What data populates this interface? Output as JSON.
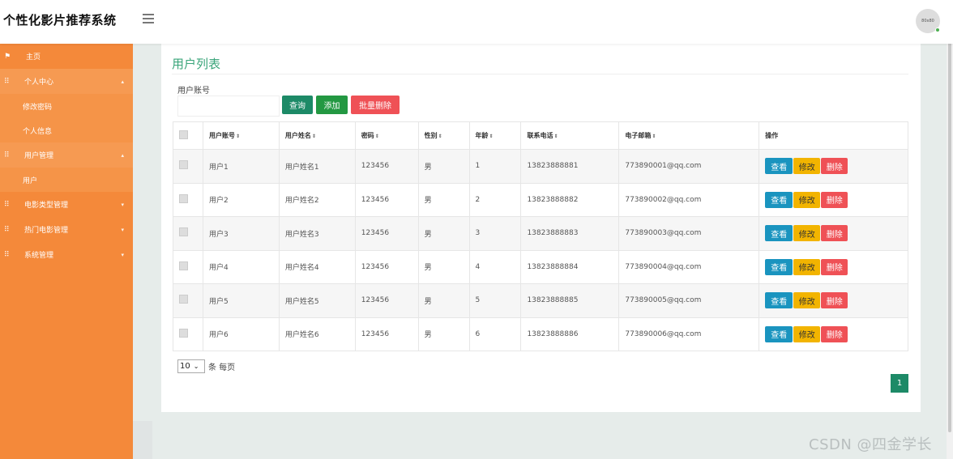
{
  "header": {
    "title": "个性化影片推荐系统",
    "avatar_text": "80x80"
  },
  "sidebar": {
    "home": "主页",
    "personal_center": "个人中心",
    "change_password": "修改密码",
    "personal_info": "个人信息",
    "user_management": "用户管理",
    "users": "用户",
    "movie_type_management": "电影类型管理",
    "hot_movie_management": "热门电影管理",
    "system_management": "系统管理"
  },
  "main": {
    "title": "用户列表",
    "search_label": "用户账号",
    "search_value": "",
    "buttons": {
      "query": "查询",
      "add": "添加",
      "batch_delete": "批量删除"
    },
    "columns": [
      "用户账号",
      "用户姓名",
      "密码",
      "性别",
      "年龄",
      "联系电话",
      "电子邮箱",
      "操作"
    ],
    "sort_icon": "⇕",
    "rows": [
      {
        "account": "用户1",
        "name": "用户姓名1",
        "password": "123456",
        "gender": "男",
        "age": "1",
        "phone": "13823888881",
        "email": "773890001@qq.com"
      },
      {
        "account": "用户2",
        "name": "用户姓名2",
        "password": "123456",
        "gender": "男",
        "age": "2",
        "phone": "13823888882",
        "email": "773890002@qq.com"
      },
      {
        "account": "用户3",
        "name": "用户姓名3",
        "password": "123456",
        "gender": "男",
        "age": "3",
        "phone": "13823888883",
        "email": "773890003@qq.com"
      },
      {
        "account": "用户4",
        "name": "用户姓名4",
        "password": "123456",
        "gender": "男",
        "age": "4",
        "phone": "13823888884",
        "email": "773890004@qq.com"
      },
      {
        "account": "用户5",
        "name": "用户姓名5",
        "password": "123456",
        "gender": "男",
        "age": "5",
        "phone": "13823888885",
        "email": "773890005@qq.com"
      },
      {
        "account": "用户6",
        "name": "用户姓名6",
        "password": "123456",
        "gender": "男",
        "age": "6",
        "phone": "13823888886",
        "email": "773890006@qq.com"
      }
    ],
    "row_actions": {
      "view": "查看",
      "edit": "修改",
      "delete": "删除"
    },
    "page_size": "10",
    "page_size_suffix": "条 每页",
    "current_page": "1"
  },
  "watermark": "CSDN @四金学长",
  "colors": {
    "sidebar": "#f4893a",
    "accent": "#1d8a67",
    "title": "#3aa57a",
    "danger": "#ef5156",
    "warning": "#f2b400",
    "info": "#1a94bf"
  }
}
